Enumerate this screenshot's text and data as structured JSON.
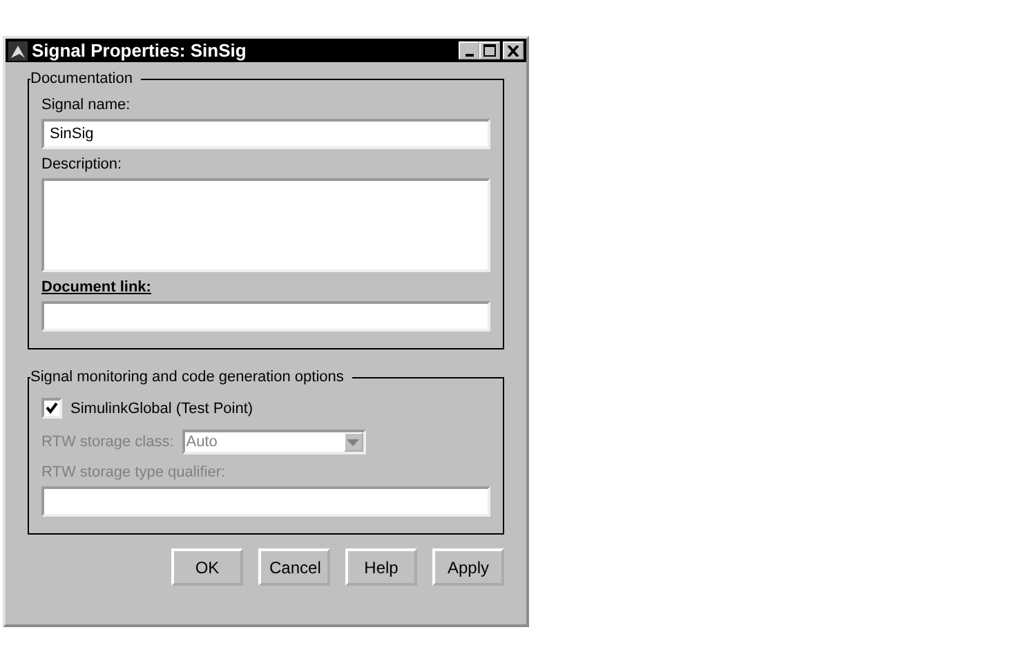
{
  "window": {
    "title": "Signal Properties: SinSig"
  },
  "documentation": {
    "legend": "Documentation",
    "fields": [
      {
        "label": "Signal name:",
        "is_link": false,
        "kind": "text",
        "value": "SinSig"
      },
      {
        "label": "Description:",
        "is_link": false,
        "kind": "textarea"
      },
      {
        "label": "Document link:",
        "is_link": true,
        "kind": "text"
      }
    ]
  },
  "monitoring": {
    "legend": "Signal monitoring and code generation options",
    "checkbox": {
      "label": "SimulinkGlobal (Test Point)",
      "checked": true
    },
    "storage_class": {
      "label": "RTW storage class:",
      "value": "Auto",
      "disabled": true
    },
    "type_qualifier": {
      "label": "RTW storage type qualifier:",
      "disabled": true
    }
  },
  "buttons": [
    "OK",
    "Cancel",
    "Help",
    "Apply"
  ]
}
